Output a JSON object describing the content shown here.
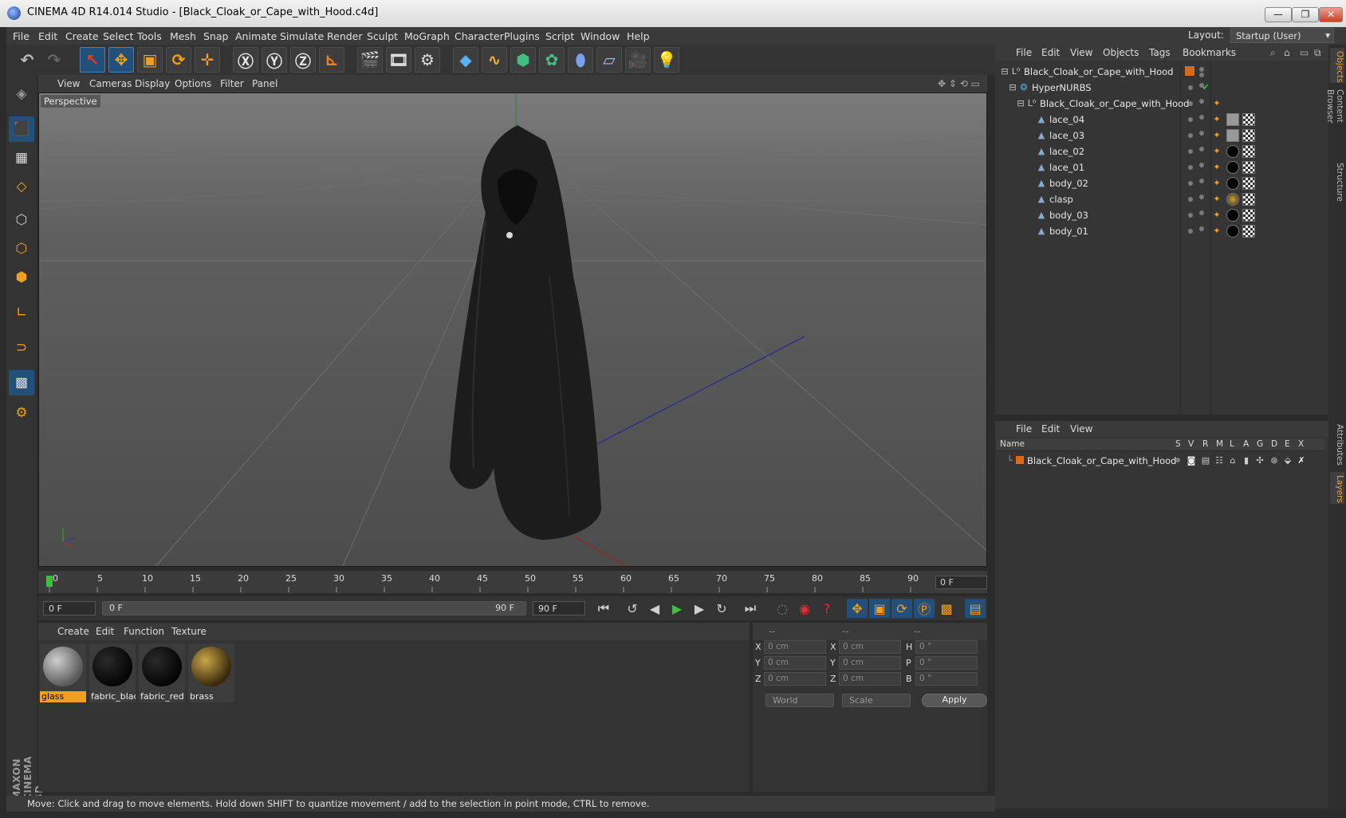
{
  "window": {
    "title": "CINEMA 4D R14.014 Studio - [Black_Cloak_or_Cape_with_Hood.c4d]",
    "controls": [
      "—",
      "❐",
      "✕"
    ]
  },
  "menubar": {
    "items": [
      "File",
      "Edit",
      "Create",
      "Select",
      "Tools",
      "Mesh",
      "Snap",
      "Animate",
      "Simulate",
      "Render",
      "Sculpt",
      "MoGraph",
      "Character",
      "Plugins",
      "Script",
      "Window",
      "Help"
    ],
    "layout_label": "Layout:",
    "layout_value": "Startup (User)"
  },
  "viewport": {
    "menu": [
      "View",
      "Cameras",
      "Display",
      "Options",
      "Filter",
      "Panel"
    ],
    "camera_label": "Perspective"
  },
  "timeline": {
    "ticks": [
      "0",
      "5",
      "10",
      "15",
      "20",
      "25",
      "30",
      "35",
      "40",
      "45",
      "50",
      "55",
      "60",
      "65",
      "70",
      "75",
      "80",
      "85",
      "90"
    ],
    "current_frame": "0 F"
  },
  "playback": {
    "start_field": "0 F",
    "range_start": "0 F",
    "range_end": "90 F",
    "end_field": "90 F"
  },
  "materials": {
    "menu": [
      "Create",
      "Edit",
      "Function",
      "Texture"
    ],
    "items": [
      {
        "name": "glass",
        "selected": true,
        "color": "#8a8a8a"
      },
      {
        "name": "fabric_blac",
        "selected": false,
        "color": "#0a0a0a"
      },
      {
        "name": "fabric_red",
        "selected": false,
        "color": "#0a0a0a"
      },
      {
        "name": "brass",
        "selected": false,
        "color": "#6a5320"
      }
    ]
  },
  "coordinates": {
    "header": [
      "--",
      "--",
      "--"
    ],
    "rows": [
      {
        "l1": "X",
        "v1": "0 cm",
        "l2": "X",
        "v2": "0 cm",
        "l3": "H",
        "v3": "0 °"
      },
      {
        "l1": "Y",
        "v1": "0 cm",
        "l2": "Y",
        "v2": "0 cm",
        "l3": "P",
        "v3": "0 °"
      },
      {
        "l1": "Z",
        "v1": "0 cm",
        "l2": "Z",
        "v2": "0 cm",
        "l3": "B",
        "v3": "0 °"
      }
    ],
    "mode": "World",
    "scale": "Scale",
    "apply": "Apply"
  },
  "status": {
    "text": "Move: Click and drag to move elements. Hold down SHIFT to quantize movement / add to the selection in point mode, CTRL to remove."
  },
  "objects": {
    "menu": [
      "File",
      "Edit",
      "View",
      "Objects",
      "Tags",
      "Bookmarks"
    ],
    "rows": [
      {
        "name": "Black_Cloak_or_Cape_with_Hood",
        "indent": 0,
        "icon": "null-icon"
      },
      {
        "name": "HyperNURBS",
        "indent": 1,
        "icon": "hypernurbs-icon"
      },
      {
        "name": "Black_Cloak_or_Cape_with_Hood",
        "indent": 2,
        "icon": "null-icon"
      },
      {
        "name": "lace_04",
        "indent": 3,
        "icon": "polygon-icon"
      },
      {
        "name": "lace_03",
        "indent": 3,
        "icon": "polygon-icon"
      },
      {
        "name": "lace_02",
        "indent": 3,
        "icon": "polygon-icon"
      },
      {
        "name": "lace_01",
        "indent": 3,
        "icon": "polygon-icon"
      },
      {
        "name": "body_02",
        "indent": 3,
        "icon": "polygon-icon"
      },
      {
        "name": "clasp",
        "indent": 3,
        "icon": "polygon-icon"
      },
      {
        "name": "body_03",
        "indent": 3,
        "icon": "polygon-icon"
      },
      {
        "name": "body_01",
        "indent": 3,
        "icon": "polygon-icon"
      }
    ]
  },
  "layers": {
    "menu": [
      "File",
      "Edit",
      "View"
    ],
    "columns": [
      "Name",
      "S",
      "V",
      "R",
      "M",
      "L",
      "A",
      "G",
      "D",
      "E",
      "X"
    ],
    "rows": [
      {
        "name": "Black_Cloak_or_Cape_with_Hood",
        "color": "#d96a1a"
      }
    ]
  },
  "right_tabs": [
    "Objects",
    "Content Browser",
    "Structure",
    "Attributes",
    "Layers"
  ]
}
